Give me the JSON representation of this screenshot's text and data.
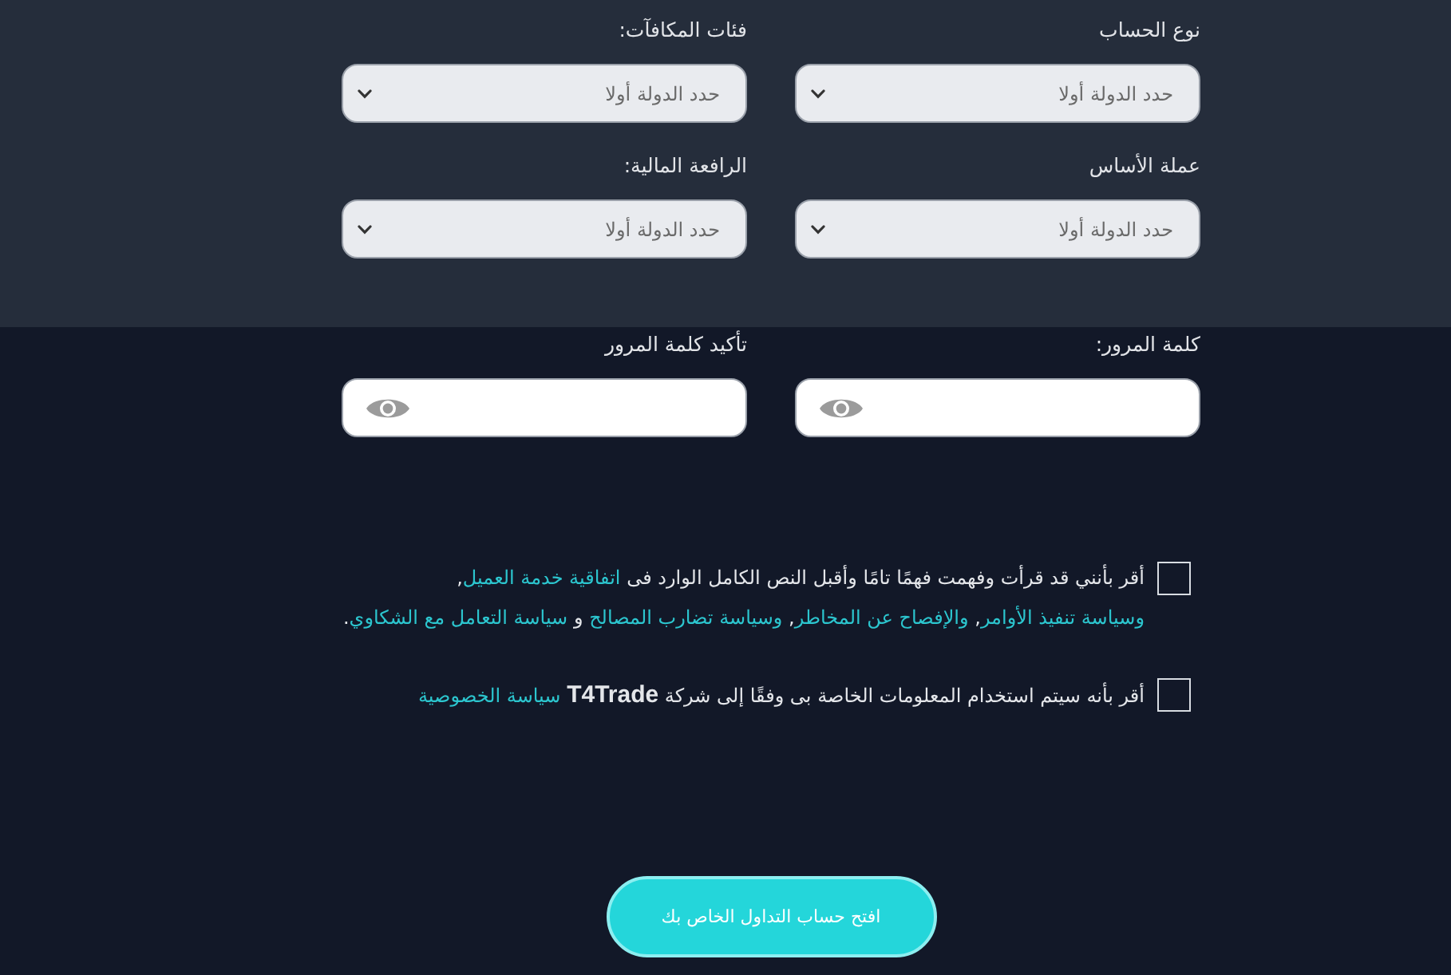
{
  "account_fields": [
    {
      "label": "نوع الحساب",
      "placeholder": "حدد الدولة أولا"
    },
    {
      "label": "فئات المكافآت:",
      "placeholder": "حدد الدولة أولا"
    },
    {
      "label": "عملة الأساس",
      "placeholder": "حدد الدولة أولا"
    },
    {
      "label": "الرافعة المالية:",
      "placeholder": "حدد الدولة أولا"
    }
  ],
  "password_fields": [
    {
      "label": "كلمة المرور:"
    },
    {
      "label": "تأكيد كلمة المرور"
    }
  ],
  "agreements": [
    {
      "checked": false,
      "parts": [
        {
          "kind": "text",
          "text": "أقر بأنني قد قرأت وفهمت فهمًا تامًا وأقبل النص الكامل الوارد فى "
        },
        {
          "kind": "link",
          "text": "اتفاقية خدمة العميل"
        },
        {
          "kind": "text",
          "text": ",  "
        },
        {
          "kind": "link",
          "text": "وسياسة تنفيذ الأوامر"
        },
        {
          "kind": "text",
          "text": ", "
        },
        {
          "kind": "link",
          "text": "والإفصاح عن المخاطر"
        },
        {
          "kind": "text",
          "text": ", "
        },
        {
          "kind": "link",
          "text": "وسياسة تضارب المصالح"
        },
        {
          "kind": "text",
          "text": " و "
        },
        {
          "kind": "link",
          "text": "سياسة التعامل مع الشكاوي"
        },
        {
          "kind": "text",
          "text": "."
        }
      ]
    },
    {
      "checked": false,
      "parts": [
        {
          "kind": "text",
          "text": "أقر بأنه سيتم استخدام المعلومات الخاصة بى وفقًا إلى شركة **T4Trade** "
        },
        {
          "kind": "link",
          "text": "سياسة الخصوصية"
        }
      ]
    }
  ],
  "submit_button": "افتح حساب التداول الخاص بك"
}
